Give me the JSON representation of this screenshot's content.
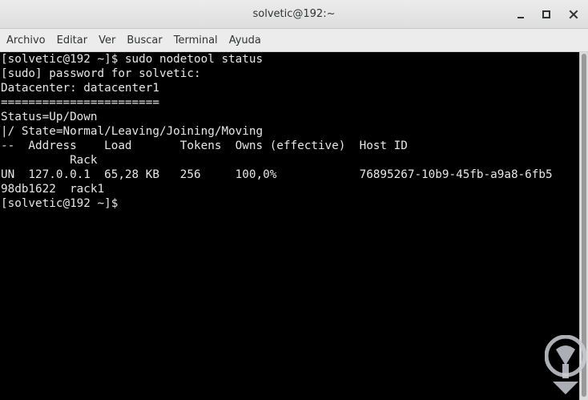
{
  "window": {
    "title": "solvetic@192:~"
  },
  "menu": {
    "items": [
      "Archivo",
      "Editar",
      "Ver",
      "Buscar",
      "Terminal",
      "Ayuda"
    ]
  },
  "terminal": {
    "lines": [
      "[solvetic@192 ~]$ sudo nodetool status",
      "[sudo] password for solvetic:",
      "Datacenter: datacenter1",
      "=======================",
      "Status=Up/Down",
      "|/ State=Normal/Leaving/Joining/Moving",
      "--  Address    Load       Tokens  Owns (effective)  Host ID",
      "          Rack",
      "UN  127.0.0.1  65,28 KB   256     100,0%            76895267-10b9-45fb-a9a8-6fb5",
      "98db1622  rack1",
      "[solvetic@192 ~]$"
    ]
  },
  "icons": {
    "minimize": "minimize-icon",
    "maximize": "maximize-icon",
    "close": "close-icon",
    "watermark": "solvetic-logo"
  },
  "colors": {
    "terminal_bg": "#000000",
    "terminal_fg": "#e6e6e6",
    "watermark": "#c9ccd4"
  }
}
